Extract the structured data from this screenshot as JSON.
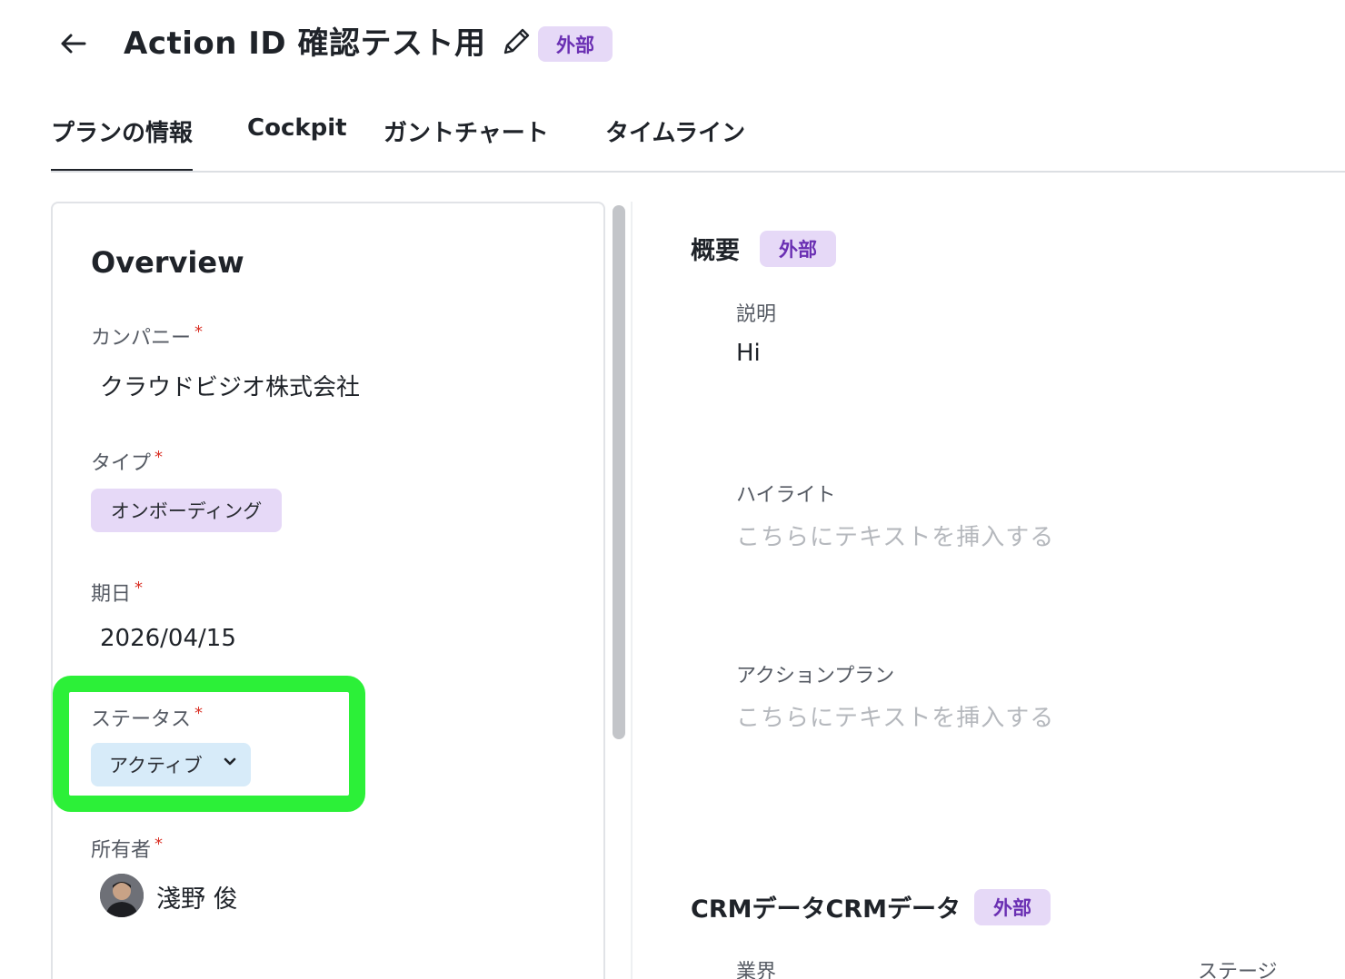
{
  "header": {
    "title": "Action ID 確認テスト用",
    "badge": "外部",
    "back_icon": "arrow-left-icon",
    "edit_icon": "pencil-icon"
  },
  "tabs": [
    {
      "label": "プランの情報",
      "active": true
    },
    {
      "label": "Cockpit",
      "active": false
    },
    {
      "label": "ガントチャート",
      "active": false
    },
    {
      "label": "タイムライン",
      "active": false
    }
  ],
  "overview": {
    "title": "Overview",
    "required_mark": "*",
    "company": {
      "label": "カンパニー",
      "value": "クラウドビジオ株式会社"
    },
    "type": {
      "label": "タイプ",
      "value": "オンボーディング"
    },
    "due_date": {
      "label": "期日",
      "value": "2026/04/15"
    },
    "status": {
      "label": "ステータス",
      "value": "アクティブ"
    },
    "owner": {
      "label": "所有者",
      "name": "淺野 俊"
    }
  },
  "summary": {
    "title": "概要",
    "badge": "外部",
    "description": {
      "label": "説明",
      "value": "Hi"
    },
    "highlight": {
      "label": "ハイライト",
      "placeholder": "こちらにテキストを挿入する"
    },
    "action_plan": {
      "label": "アクションプラン",
      "placeholder": "こちらにテキストを挿入する"
    }
  },
  "crm": {
    "title": "CRMデータCRMデータ",
    "badge": "外部",
    "industry_label": "業界",
    "stage_label": "ステージ"
  },
  "colors": {
    "badge_bg": "#e6d9f7",
    "badge_text": "#6a2fb3",
    "status_bg": "#d7ebf9",
    "highlight_outline": "#2cf038",
    "required": "#d93025"
  }
}
